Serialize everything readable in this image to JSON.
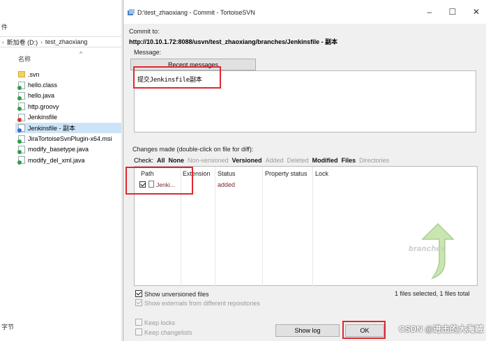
{
  "explorer": {
    "top_char": "件",
    "address": [
      "新加卷 (D:)",
      "test_zhaoxiang"
    ],
    "column_header": "名称",
    "files": [
      {
        "name": ".svn",
        "icon": "folder-icon"
      },
      {
        "name": "hello.class",
        "icon": "svn-file-icon"
      },
      {
        "name": "hello.java",
        "icon": "svn-file-icon"
      },
      {
        "name": "http.groovy",
        "icon": "svn-file-icon"
      },
      {
        "name": "Jenkinsfile",
        "icon": "svn-modified-file-icon"
      },
      {
        "name": "Jenkinsfile - 副本",
        "icon": "svn-added-file-icon",
        "selected": true
      },
      {
        "name": "JiraTortoiseSvnPlugin-x64.msi",
        "icon": "svn-file-icon"
      },
      {
        "name": "modify_basetype.java",
        "icon": "svn-file-icon"
      },
      {
        "name": "modify_del_xml.java",
        "icon": "svn-file-icon"
      }
    ],
    "bottom_label": "字节"
  },
  "dialog": {
    "title": "D:\\test_zhaoxiang - Commit - TortoiseSVN",
    "commit_to_label": "Commit to:",
    "url": "http://10.10.1.72:8088/usvn/test_zhaoxiang/branches/Jenkinsfile - 副本",
    "message_label": "Message:",
    "recent_messages": "Recent messages",
    "message_text": "提交Jenkinsfile副本",
    "changes_label": "Changes made (double-click on file for diff):",
    "check_label": "Check:",
    "check_all": "All",
    "check_none": "None",
    "check_nonversioned": "Non-versioned",
    "check_versioned": "Versioned",
    "check_added": "Added",
    "check_deleted": "Deleted",
    "check_modified": "Modified",
    "check_files": "Files",
    "check_directories": "Directories",
    "columns": [
      "Path",
      "Extension",
      "Status",
      "Property status",
      "Lock"
    ],
    "row": {
      "path": "Jenki...",
      "status": "added",
      "checked": true
    },
    "watermark": "branches",
    "show_unversioned": "Show unversioned files",
    "show_externals": "Show externals from different repositories",
    "selection_info": "1 files selected, 1 files total",
    "keep_locks": "Keep locks",
    "keep_changelists": "Keep changelists",
    "show_log": "Show log",
    "ok_label": "OK"
  },
  "colors": {
    "highlight_red": "#e0272e",
    "added_status": "#7a2a2a",
    "selected_row": "#cce4f7"
  },
  "watermark_site": "CSDN @进击的大海贼"
}
